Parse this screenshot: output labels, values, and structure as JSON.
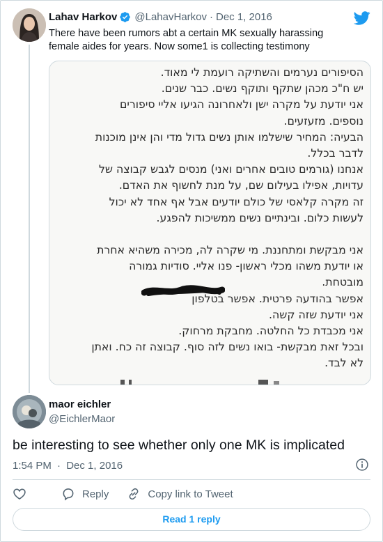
{
  "parent_tweet": {
    "author_name": "Lahav Harkov",
    "author_handle": "@LahavHarkov",
    "separator": "·",
    "date": "Dec 1, 2016",
    "text": "There have been rumors abt a certain MK sexually harassing female aides for years. Now some1 is collecting testimony",
    "verified": true,
    "icons": [
      "verified-badge-icon",
      "twitter-bird-icon"
    ],
    "image_lines": [
      "הסיפורים נערמים והשתיקה רועמת לי מאוד.",
      "יש ח\"כ מכהן שתקף ותוקף נשים. כבר שנים.",
      "אני יודעת על מקרה ישן ולאחרונה הגיעו אליי סיפורים",
      "נוספים. מזעזעים.",
      "הבעיה: המחיר שישלמו אותן נשים גדול מדי והן אינן מוכנות",
      "לדבר בכלל.",
      "אנחנו (גורמים טובים אחרים ואני) מנסים לגבש קבוצה של",
      "עדויות, אפילו בעילום שם, על מנת לחשוף את האדם.",
      "זה מקרה קלאסי של כולם יודעים אבל אף אחד לא יכול",
      "לעשות כלום. ובינתיים נשים ממשיכות להפגע.",
      "",
      "אני מבקשת ומתחננת. מי שקרה לה, מכירה משהיא אחרת",
      "או יודעת משהו מכלי ראשון- פנו אליי. סודיות גמורה",
      "מובטחת.",
      "אפשר בהודעה פרטית. אפשר בטלפון",
      "אני יודעת שזה קשה.",
      "אני מכבדת כל החלטה. מחבקת מרחוק.",
      "ובכל זאת מבקשת- בואו נשים לזה סוף. קבוצה זה כח. ואתן",
      "לא לבד."
    ]
  },
  "reply_tweet": {
    "author_name": "maor eichler",
    "author_handle": "@EichlerMaor",
    "text": "be interesting to see whether only one MK is implicated",
    "time": "1:54 PM",
    "separator": "·",
    "date": "Dec 1, 2016"
  },
  "actions": {
    "reply_label": "Reply",
    "copy_link_label": "Copy link to Tweet",
    "read_replies_label": "Read 1 reply"
  },
  "colors": {
    "accent": "#1d9bf0",
    "secondary_text": "#536471",
    "border": "#cfd9de",
    "primary_text": "#0f1419"
  }
}
